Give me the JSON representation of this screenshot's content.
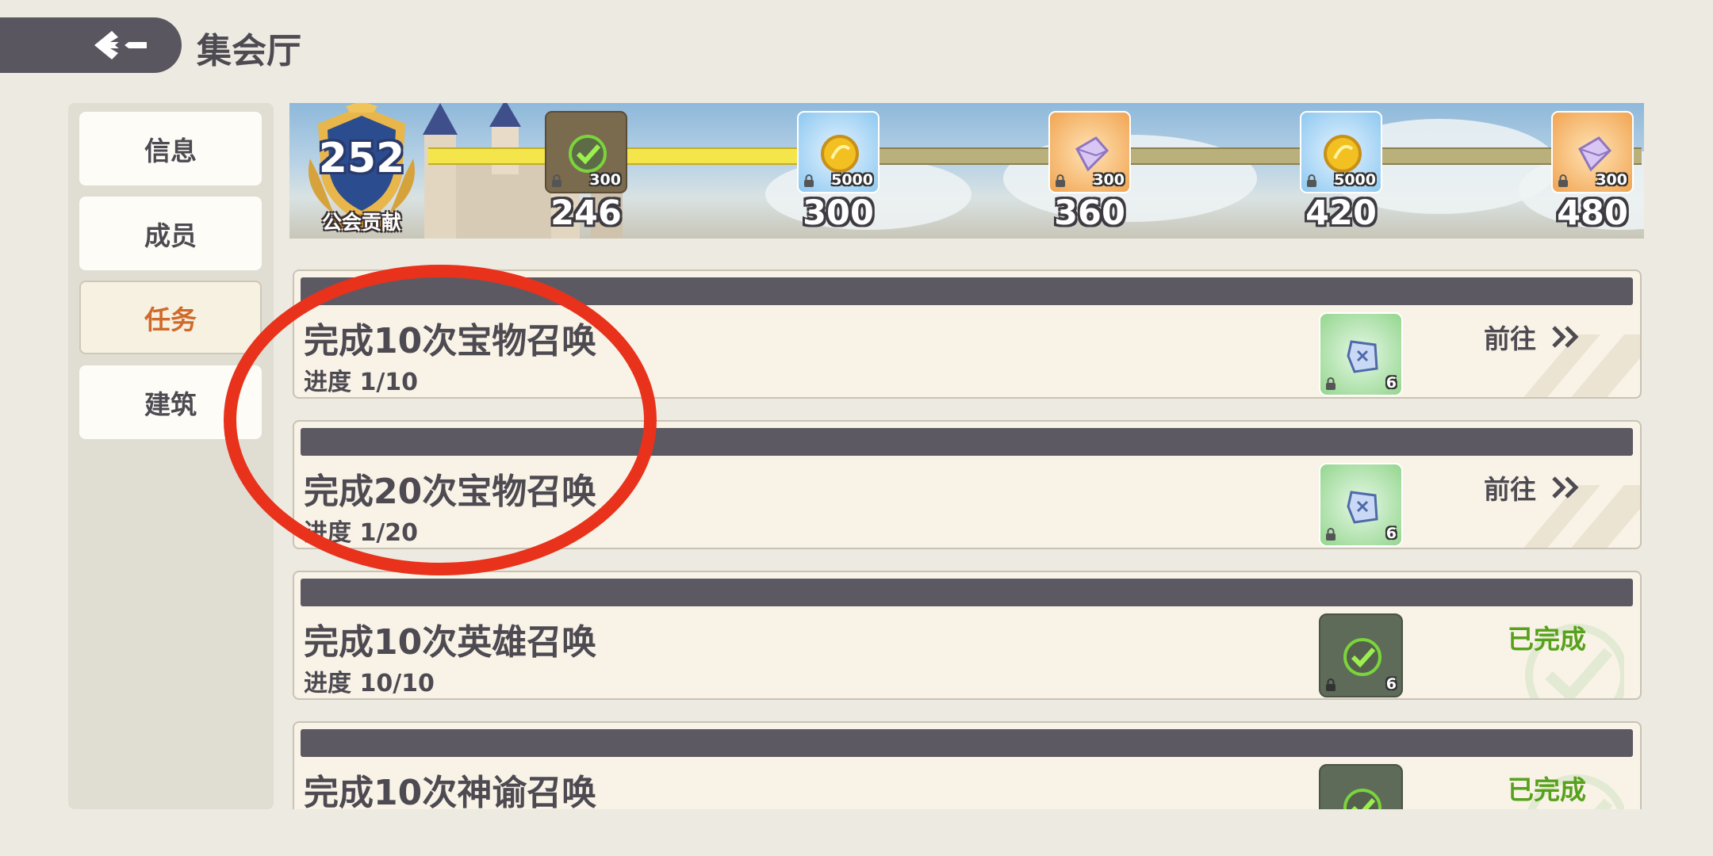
{
  "header": {
    "title": "集会厅",
    "back_icon": "back-arrow-icon"
  },
  "sidebar": {
    "items": [
      {
        "label": "信息",
        "active": false
      },
      {
        "label": "成员",
        "active": false
      },
      {
        "label": "任务",
        "active": true
      },
      {
        "label": "建筑",
        "active": false
      }
    ]
  },
  "contribution": {
    "value": "252",
    "label": "公会贡献",
    "progress_fill": "partial: reached 246 milestone",
    "milestones": [
      {
        "threshold": "246",
        "reward_qty": "300",
        "reward": "claimed",
        "style": "done"
      },
      {
        "threshold": "300",
        "reward_qty": "5000",
        "reward": "gold-coin-icon",
        "style": "blue"
      },
      {
        "threshold": "360",
        "reward_qty": "300",
        "reward": "crystal-icon",
        "style": "orange"
      },
      {
        "threshold": "420",
        "reward_qty": "5000",
        "reward": "gold-coin-icon",
        "style": "blue"
      },
      {
        "threshold": "480",
        "reward_qty": "300",
        "reward": "crystal-icon",
        "style": "orange"
      }
    ]
  },
  "tasks": [
    {
      "title": "完成10次宝物召唤",
      "progress": "进度 1/10",
      "reward_qty": "6",
      "status": "go",
      "action": "前往"
    },
    {
      "title": "完成20次宝物召唤",
      "progress": "进度 1/20",
      "reward_qty": "6",
      "status": "go",
      "action": "前往"
    },
    {
      "title": "完成10次英雄召唤",
      "progress": "进度 10/10",
      "reward_qty": "6",
      "status": "done",
      "action": "已完成"
    },
    {
      "title": "完成10次神谕召唤",
      "progress": "",
      "reward_qty": "",
      "status": "done",
      "action": "已完成"
    }
  ],
  "colors": {
    "accent": "#cf6a2c",
    "done_green": "#58a11c",
    "bar": "#5d5963",
    "annotation": "#e8321c"
  }
}
